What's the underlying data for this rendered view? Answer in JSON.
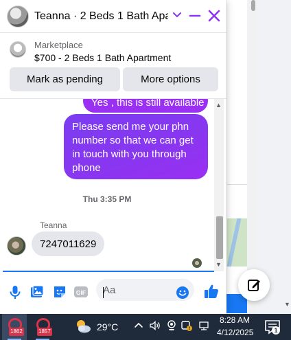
{
  "chat": {
    "title": "Teanna · 2 Beds 1 Bath Apa...",
    "listing": {
      "label": "Marketplace",
      "title": "$700 - 2 Beds 1 Bath Apartment"
    },
    "buttons": {
      "mark_pending": "Mark as pending",
      "more_options": "More options"
    },
    "messages": {
      "outgoing_partial": "Yes , this is still available",
      "outgoing_main": "Please send me your phn number so that we can get in touch with you through phone",
      "timestamp": "Thu 3:35 PM",
      "sender_name": "Teanna",
      "incoming_text": "7247011629"
    },
    "composer": {
      "placeholder": "Aa",
      "value": ""
    }
  },
  "taskbar": {
    "apps": [
      {
        "badge": "1862"
      },
      {
        "badge": "1857"
      }
    ],
    "weather": {
      "temperature": "29°C"
    },
    "clock": {
      "time": "8:28 AM",
      "date": "4/12/2025"
    },
    "notifications": {
      "count": "1"
    }
  },
  "colors": {
    "accent_purple": "#8a36f0",
    "messenger_blue": "#1877f2",
    "taskbar_bg": "#1f2a3a",
    "badge_red": "#d9334a"
  },
  "icons": [
    "chevron-down-icon",
    "minimize-icon",
    "close-icon",
    "microphone-icon",
    "photo-icon",
    "sticker-icon",
    "gif-icon",
    "emoji-icon",
    "thumbs-up-icon",
    "compose-icon",
    "weather-icon",
    "notification-icon"
  ]
}
